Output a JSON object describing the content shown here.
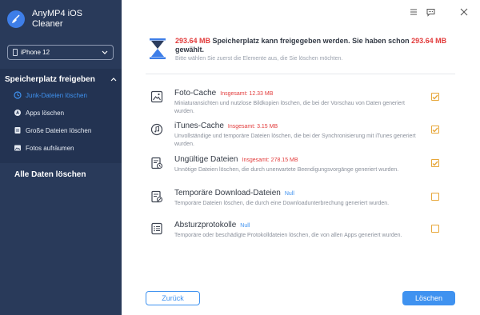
{
  "app": {
    "title_line1": "AnyMP4 iOS",
    "title_line2": "Cleaner",
    "logo_icon": "broom-icon"
  },
  "window_controls": [
    {
      "name": "menu",
      "icon": "menu-icon"
    },
    {
      "name": "feedback",
      "icon": "chat-icon"
    },
    {
      "name": "close",
      "icon": "close-icon"
    }
  ],
  "sidebar": {
    "device": "iPhone 12",
    "section_title": "Speicherplatz freigeben",
    "items": [
      {
        "label": "Junk-Dateien löschen",
        "icon": "clock-icon",
        "active": true
      },
      {
        "label": "Apps löschen",
        "icon": "apps-icon",
        "active": false
      },
      {
        "label": "Große Dateien löschen",
        "icon": "file-icon",
        "active": false
      },
      {
        "label": "Fotos aufräumen",
        "icon": "image-icon",
        "active": false
      }
    ],
    "alle_label": "Alle Daten löschen"
  },
  "header": {
    "amount1": "293.64 MB",
    "text1": " Speicherplatz kann freigegeben werden. Sie haben schon ",
    "amount2": "293.64 MB",
    "text2": "gewählt.",
    "subtitle": "Bitte wählen Sie zuerst die Elemente aus, die Sie löschen möchten."
  },
  "items": [
    {
      "title": "Foto-Cache",
      "size": "Insgesamt: 12.33 MB",
      "description": "Miniaturansichten und nutzlose Bildkopien löschen, die bei der Vorschau von Daten generiert wurden.",
      "icon": "photo-icon",
      "checked": true
    },
    {
      "title": "iTunes-Cache",
      "size": "Insgesamt: 3.15 MB",
      "description": "Unvollständige und temporäre Dateien löschen, die bei der Synchronisierung mit iTunes generiert wurden.",
      "icon": "music-icon",
      "checked": true
    },
    {
      "title": "Ungültige Dateien",
      "size": "Insgesamt: 278.15 MB",
      "description": "Unnötige Dateien löschen, die durch unerwartete Beendigungsvorgänge generiert wurden.",
      "icon": "invalid-file-icon",
      "checked": true
    },
    {
      "title": "Temporäre Download-Dateien",
      "size": "Null",
      "description": "Temporäre Dateien löschen, die durch eine Downloadunterbrechung generiert wurden.",
      "icon": "download-file-icon",
      "checked": false
    },
    {
      "title": "Absturzprotokolle",
      "size": "Null",
      "description": "Temporäre oder beschädigte Protokolldateien löschen, die von allen Apps generiert wurden.",
      "icon": "log-icon",
      "checked": false
    }
  ],
  "buttons": {
    "back": "Zurück",
    "delete": "Löschen"
  },
  "colors": {
    "sidebar_bg": "#293a5a",
    "accent": "#3f92f0",
    "highlight": "#e23b3b",
    "checkbox": "#e7a73a"
  }
}
